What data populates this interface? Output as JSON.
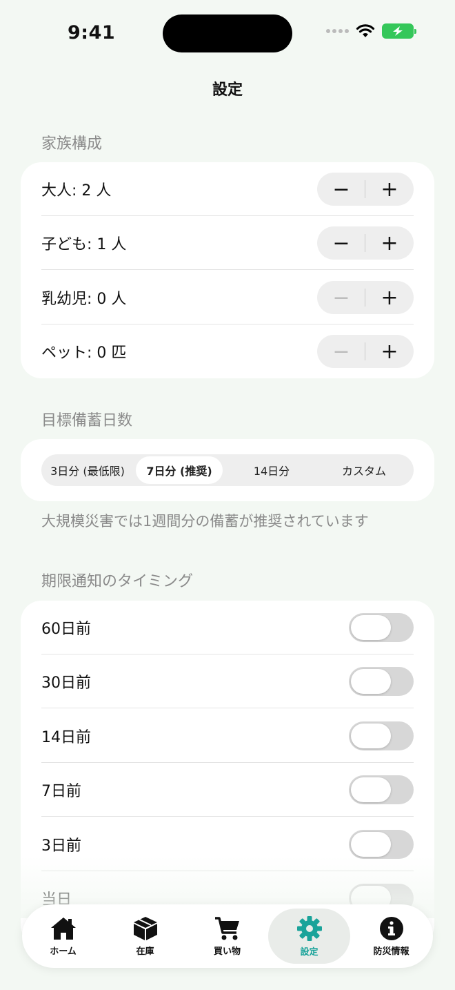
{
  "status": {
    "time": "9:41"
  },
  "nav": {
    "title": "設定"
  },
  "family": {
    "header": "家族構成",
    "rows": [
      {
        "label": "大人: 2 人",
        "minus": "−",
        "plus": "+",
        "minus_disabled": false
      },
      {
        "label": "子ども: 1 人",
        "minus": "−",
        "plus": "+",
        "minus_disabled": false
      },
      {
        "label": "乳幼児: 0 人",
        "minus": "−",
        "plus": "+",
        "minus_disabled": true
      },
      {
        "label": "ペット: 0 匹",
        "minus": "−",
        "plus": "+",
        "minus_disabled": true
      }
    ]
  },
  "target": {
    "header": "目標備蓄日数",
    "options": [
      "3日分 (最低限)",
      "7日分 (推奨)",
      "14日分",
      "カスタム"
    ],
    "selected_index": 1,
    "footnote": "大規模災害では1週間分の備蓄が推奨されています"
  },
  "notify": {
    "header": "期限通知のタイミング",
    "rows": [
      {
        "label": "60日前",
        "on": false
      },
      {
        "label": "30日前",
        "on": false
      },
      {
        "label": "14日前",
        "on": false
      },
      {
        "label": "7日前",
        "on": false
      },
      {
        "label": "3日前",
        "on": false
      },
      {
        "label": "当日",
        "on": false
      }
    ]
  },
  "tabs": [
    {
      "label": "ホーム",
      "icon": "home-icon"
    },
    {
      "label": "在庫",
      "icon": "box-icon"
    },
    {
      "label": "買い物",
      "icon": "cart-icon"
    },
    {
      "label": "設定",
      "icon": "gear-icon"
    },
    {
      "label": "防災情報",
      "icon": "info-icon"
    }
  ],
  "colors": {
    "accent": "#1aa39a",
    "battery": "#34c759"
  }
}
